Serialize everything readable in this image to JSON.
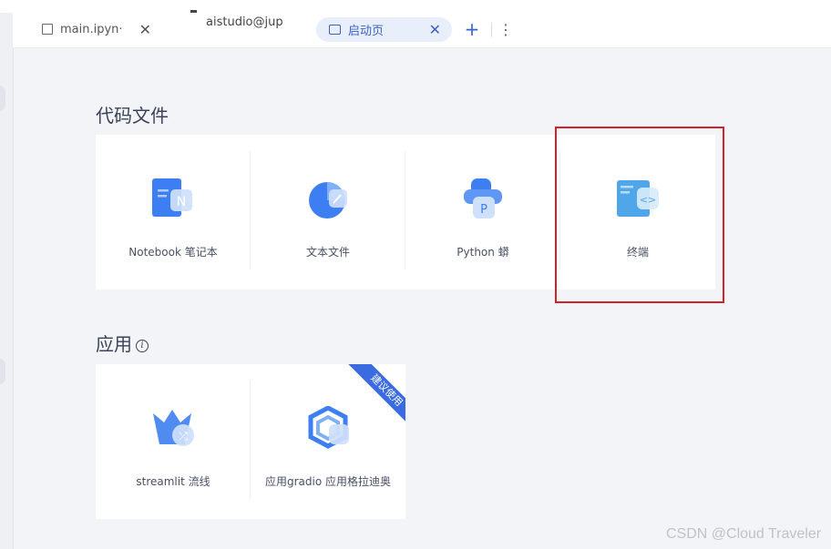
{
  "tabs": {
    "notebook": {
      "label": "main.ipyn···",
      "close": "✕"
    },
    "terminal": {
      "label": "aistudio@jup"
    },
    "launcher": {
      "label": "启动页",
      "close": "✕"
    },
    "add": "+",
    "more": "⋮"
  },
  "code_files": {
    "title": "代码文件",
    "items": [
      {
        "label": "Notebook 笔记本",
        "icon": "notebook-icon"
      },
      {
        "label": "文本文件",
        "icon": "text-file-icon"
      },
      {
        "label": "Python 蟒",
        "icon": "python-icon"
      },
      {
        "label": "终端",
        "icon": "terminal-icon"
      }
    ]
  },
  "apps": {
    "title": "应用",
    "info_icon": "i",
    "items": [
      {
        "label": "streamlit 流线",
        "icon": "streamlit-icon"
      },
      {
        "label": "应用gradio 应用格拉迪奥",
        "icon": "gradio-icon"
      }
    ],
    "ribbon": "建议使用"
  },
  "watermark": "CSDN @Cloud Traveler",
  "colors": {
    "accent": "#3a62c9",
    "highlight": "#d8202a",
    "ribbon": "#3a6be0"
  }
}
